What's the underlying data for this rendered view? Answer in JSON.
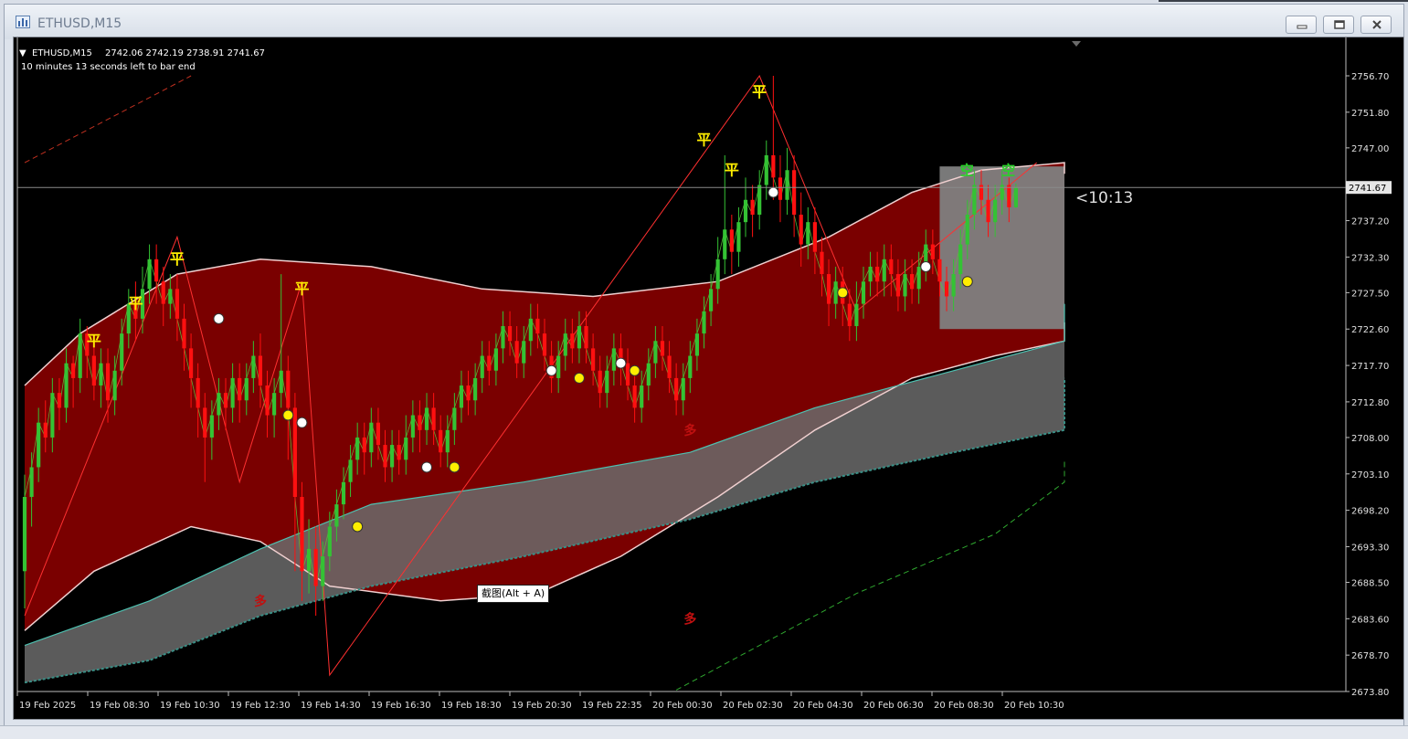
{
  "window": {
    "title": "ETHUSD,M15",
    "icon": "chart-window-icon",
    "buttons": [
      "minimize-icon",
      "restore-icon",
      "close-icon"
    ]
  },
  "chart": {
    "header_symbol": "ETHUSD,M15",
    "header_ohlc": "2742.06 2742.19 2738.91 2741.67",
    "countdown_text": "10 minutes 13 seconds left to bar end",
    "timer_label": "<10:13",
    "current_price": "2741.67",
    "tooltip": "截图(Alt + A)",
    "colors": {
      "background": "#000000",
      "band_fill": "#7a0000",
      "bull_candle": "#34c234",
      "bear_candle": "#ff1010",
      "grey_band": "#808080",
      "teal_line": "#4ec0b0",
      "signal_yellow": "#ffee00"
    }
  },
  "chart_data": {
    "type": "candlestick",
    "y_axis_ticks": [
      "2756.70",
      "2751.80",
      "2747.00",
      "2742.10",
      "2737.20",
      "2732.30",
      "2727.50",
      "2722.60",
      "2717.70",
      "2712.80",
      "2708.00",
      "2703.10",
      "2698.20",
      "2693.30",
      "2688.50",
      "2683.60",
      "2678.70",
      "2673.80"
    ],
    "x_axis_ticks": [
      "19 Feb 2025",
      "19 Feb 08:30",
      "19 Feb 10:30",
      "19 Feb 12:30",
      "19 Feb 14:30",
      "19 Feb 16:30",
      "19 Feb 18:30",
      "19 Feb 20:30",
      "19 Feb 22:35",
      "20 Feb 00:30",
      "20 Feb 02:30",
      "20 Feb 04:30",
      "20 Feb 06:30",
      "20 Feb 08:30",
      "20 Feb 10:30"
    ],
    "ylim": [
      2673.8,
      2756.7
    ],
    "upper_band": [
      [
        0,
        2715
      ],
      [
        8,
        2722
      ],
      [
        22,
        2730
      ],
      [
        34,
        2732
      ],
      [
        50,
        2731
      ],
      [
        66,
        2728
      ],
      [
        82,
        2727
      ],
      [
        100,
        2729
      ],
      [
        116,
        2735
      ],
      [
        128,
        2741
      ],
      [
        138,
        2744
      ],
      [
        150,
        2745
      ],
      [
        172,
        2744.5
      ],
      [
        190,
        2743.5
      ]
    ],
    "lower_band": [
      [
        0,
        2682
      ],
      [
        10,
        2690
      ],
      [
        24,
        2696
      ],
      [
        34,
        2694
      ],
      [
        44,
        2688
      ],
      [
        60,
        2686
      ],
      [
        74,
        2687
      ],
      [
        86,
        2692
      ],
      [
        100,
        2700
      ],
      [
        114,
        2709
      ],
      [
        128,
        2716
      ],
      [
        140,
        2719
      ],
      [
        156,
        2721
      ],
      [
        170,
        2722.5
      ],
      [
        190,
        2723.5
      ]
    ],
    "mid_line": [
      [
        0,
        2680
      ],
      [
        18,
        2686
      ],
      [
        34,
        2693
      ],
      [
        50,
        2699
      ],
      [
        72,
        2702
      ],
      [
        96,
        2706
      ],
      [
        114,
        2712
      ],
      [
        134,
        2717
      ],
      [
        154,
        2721
      ],
      [
        172,
        2724
      ],
      [
        190,
        2726
      ]
    ],
    "grey_lower": [
      [
        0,
        2675
      ],
      [
        18,
        2678
      ],
      [
        34,
        2684
      ],
      [
        50,
        2688
      ],
      [
        72,
        2692
      ],
      [
        96,
        2697
      ],
      [
        114,
        2702
      ],
      [
        134,
        2706
      ],
      [
        154,
        2709
      ],
      [
        172,
        2713
      ],
      [
        190,
        2716
      ]
    ],
    "green_dashed": [
      [
        94,
        2674
      ],
      [
        120,
        2687
      ],
      [
        140,
        2695
      ],
      [
        166,
        2702
      ],
      [
        190,
        2705
      ]
    ],
    "red_dashed": [
      [
        0,
        2745
      ],
      [
        24,
        2756.7
      ]
    ],
    "candles": [
      [
        2690,
        2700,
        2685,
        2703
      ],
      [
        2700,
        2704,
        2696,
        2706
      ],
      [
        2704,
        2710,
        2702,
        2712
      ],
      [
        2710,
        2708,
        2706,
        2713
      ],
      [
        2708,
        2714,
        2706,
        2716
      ],
      [
        2714,
        2712,
        2709,
        2716
      ],
      [
        2712,
        2718,
        2710,
        2720
      ],
      [
        2718,
        2716,
        2712,
        2719
      ],
      [
        2716,
        2722,
        2714,
        2724
      ],
      [
        2722,
        2719,
        2716,
        2723
      ],
      [
        2719,
        2715,
        2713,
        2721
      ],
      [
        2715,
        2718,
        2712,
        2720
      ],
      [
        2718,
        2713,
        2710,
        2720
      ],
      [
        2713,
        2717,
        2711,
        2719
      ],
      [
        2717,
        2722,
        2715,
        2724
      ],
      [
        2722,
        2726,
        2720,
        2728
      ],
      [
        2726,
        2724,
        2721,
        2729
      ],
      [
        2724,
        2728,
        2722,
        2731
      ],
      [
        2728,
        2732,
        2726,
        2734
      ],
      [
        2732,
        2729,
        2726,
        2734
      ],
      [
        2729,
        2726,
        2723,
        2731
      ],
      [
        2726,
        2728,
        2724,
        2730
      ],
      [
        2728,
        2724,
        2721,
        2730
      ],
      [
        2724,
        2720,
        2717,
        2726
      ],
      [
        2720,
        2716,
        2712,
        2722
      ],
      [
        2716,
        2712,
        2708,
        2718
      ],
      [
        2712,
        2708,
        2702,
        2714
      ],
      [
        2708,
        2711,
        2705,
        2713
      ],
      [
        2711,
        2714,
        2709,
        2716
      ],
      [
        2714,
        2712,
        2709,
        2716
      ],
      [
        2712,
        2716,
        2710,
        2718
      ],
      [
        2716,
        2713,
        2710,
        2718
      ],
      [
        2713,
        2716,
        2711,
        2718
      ],
      [
        2716,
        2719,
        2714,
        2721
      ],
      [
        2719,
        2715,
        2712,
        2722
      ],
      [
        2715,
        2711,
        2708,
        2717
      ],
      [
        2711,
        2714,
        2708,
        2716
      ],
      [
        2714,
        2717,
        2712,
        2730
      ],
      [
        2717,
        2712,
        2705,
        2719
      ],
      [
        2712,
        2700,
        2690,
        2714
      ],
      [
        2700,
        2690,
        2686,
        2702
      ],
      [
        2690,
        2693,
        2687,
        2697
      ],
      [
        2693,
        2688,
        2684,
        2696
      ],
      [
        2688,
        2692,
        2686,
        2694
      ],
      [
        2692,
        2696,
        2690,
        2698
      ],
      [
        2696,
        2699,
        2694,
        2701
      ],
      [
        2699,
        2702,
        2697,
        2704
      ],
      [
        2702,
        2705,
        2700,
        2707
      ],
      [
        2705,
        2708,
        2703,
        2710
      ],
      [
        2708,
        2706,
        2703,
        2710
      ],
      [
        2706,
        2710,
        2704,
        2712
      ],
      [
        2710,
        2707,
        2705,
        2712
      ],
      [
        2707,
        2704,
        2702,
        2709
      ],
      [
        2704,
        2707,
        2702,
        2709
      ],
      [
        2707,
        2705,
        2703,
        2709
      ],
      [
        2705,
        2708,
        2703,
        2711
      ],
      [
        2708,
        2711,
        2706,
        2713
      ],
      [
        2711,
        2709,
        2706,
        2713
      ],
      [
        2709,
        2712,
        2707,
        2714
      ],
      [
        2712,
        2709,
        2707,
        2714
      ],
      [
        2709,
        2706,
        2704,
        2711
      ],
      [
        2706,
        2709,
        2704,
        2711
      ],
      [
        2709,
        2712,
        2707,
        2714
      ],
      [
        2712,
        2715,
        2710,
        2717
      ],
      [
        2715,
        2713,
        2711,
        2717
      ],
      [
        2713,
        2716,
        2711,
        2718
      ],
      [
        2716,
        2719,
        2714,
        2721
      ],
      [
        2719,
        2717,
        2715,
        2721
      ],
      [
        2717,
        2720,
        2715,
        2722
      ],
      [
        2720,
        2723,
        2718,
        2725
      ],
      [
        2723,
        2721,
        2719,
        2725
      ],
      [
        2721,
        2718,
        2716,
        2723
      ],
      [
        2718,
        2721,
        2716,
        2723
      ],
      [
        2721,
        2724,
        2719,
        2726
      ],
      [
        2724,
        2722,
        2720,
        2726
      ],
      [
        2722,
        2719,
        2717,
        2724
      ],
      [
        2719,
        2716,
        2714,
        2721
      ],
      [
        2716,
        2719,
        2714,
        2721
      ],
      [
        2719,
        2722,
        2717,
        2724
      ],
      [
        2722,
        2720,
        2718,
        2724
      ],
      [
        2720,
        2723,
        2718,
        2725
      ],
      [
        2723,
        2720,
        2718,
        2725
      ],
      [
        2720,
        2717,
        2715,
        2722
      ],
      [
        2717,
        2714,
        2712,
        2719
      ],
      [
        2714,
        2717,
        2712,
        2719
      ],
      [
        2717,
        2720,
        2715,
        2722
      ],
      [
        2720,
        2718,
        2715,
        2722
      ],
      [
        2718,
        2715,
        2713,
        2720
      ],
      [
        2715,
        2712,
        2710,
        2717
      ],
      [
        2712,
        2715,
        2710,
        2717
      ],
      [
        2715,
        2718,
        2713,
        2720
      ],
      [
        2718,
        2721,
        2716,
        2723
      ],
      [
        2721,
        2719,
        2717,
        2723
      ],
      [
        2719,
        2716,
        2714,
        2721
      ],
      [
        2716,
        2713,
        2711,
        2718
      ],
      [
        2713,
        2716,
        2711,
        2718
      ],
      [
        2716,
        2719,
        2714,
        2721
      ],
      [
        2719,
        2722,
        2717,
        2724
      ],
      [
        2722,
        2725,
        2720,
        2727
      ],
      [
        2725,
        2728,
        2723,
        2730
      ],
      [
        2728,
        2732,
        2726,
        2735
      ],
      [
        2732,
        2736,
        2730,
        2746
      ],
      [
        2736,
        2733,
        2730,
        2738
      ],
      [
        2733,
        2737,
        2731,
        2739
      ],
      [
        2737,
        2740,
        2735,
        2743
      ],
      [
        2740,
        2738,
        2735,
        2742
      ],
      [
        2738,
        2742,
        2736,
        2744
      ],
      [
        2742,
        2746,
        2740,
        2748
      ],
      [
        2746,
        2743,
        2740,
        2756.7
      ],
      [
        2743,
        2740,
        2737,
        2746
      ],
      [
        2740,
        2744,
        2738,
        2747
      ],
      [
        2744,
        2738,
        2735,
        2746
      ],
      [
        2738,
        2734,
        2731,
        2741
      ],
      [
        2734,
        2737,
        2732,
        2739
      ],
      [
        2737,
        2733,
        2730,
        2739
      ],
      [
        2733,
        2730,
        2727,
        2735
      ],
      [
        2730,
        2726,
        2723,
        2732
      ],
      [
        2726,
        2729,
        2724,
        2731
      ],
      [
        2729,
        2726,
        2723,
        2731
      ],
      [
        2726,
        2723,
        2721,
        2728
      ],
      [
        2723,
        2726,
        2721,
        2729
      ],
      [
        2726,
        2729,
        2724,
        2731
      ],
      [
        2729,
        2731,
        2727,
        2733
      ],
      [
        2731,
        2729,
        2727,
        2733
      ],
      [
        2729,
        2732,
        2727,
        2734
      ],
      [
        2732,
        2730,
        2727,
        2734
      ],
      [
        2730,
        2727,
        2725,
        2732
      ],
      [
        2727,
        2730,
        2725,
        2732
      ],
      [
        2730,
        2728,
        2726,
        2732
      ],
      [
        2728,
        2731,
        2726,
        2733
      ],
      [
        2731,
        2734,
        2729,
        2736
      ],
      [
        2734,
        2732,
        2730,
        2736
      ],
      [
        2732,
        2729,
        2727,
        2734
      ],
      [
        2729,
        2727,
        2725,
        2731
      ],
      [
        2727,
        2730,
        2725,
        2732
      ],
      [
        2730,
        2734,
        2728,
        2736
      ],
      [
        2734,
        2738,
        2732,
        2740
      ],
      [
        2738,
        2742,
        2736,
        2744
      ],
      [
        2742,
        2740,
        2738,
        2744
      ],
      [
        2740,
        2737,
        2735,
        2742
      ],
      [
        2737,
        2740,
        2735,
        2742
      ],
      [
        2740,
        2742,
        2738,
        2744
      ],
      [
        2742,
        2739,
        2737,
        2743
      ],
      [
        2739,
        2741.67,
        2738.91,
        2742.19
      ]
    ],
    "signals": {
      "exit_labels": [
        [
          10,
          2721
        ],
        [
          16,
          2726
        ],
        [
          22,
          2732
        ],
        [
          40,
          2728
        ],
        [
          98,
          2748
        ],
        [
          102,
          2744
        ],
        [
          106,
          2754.5
        ]
      ],
      "entry_labels": [
        [
          34,
          2686
        ],
        [
          96,
          2709
        ],
        [
          96,
          2683.6
        ]
      ],
      "white_dots": [
        [
          28,
          2724
        ],
        [
          40,
          2710
        ],
        [
          58,
          2704
        ],
        [
          76,
          2717
        ],
        [
          86,
          2718
        ],
        [
          108,
          2741
        ],
        [
          130,
          2731
        ]
      ],
      "yellow_dots": [
        [
          38,
          2711
        ],
        [
          48,
          2696
        ],
        [
          62,
          2704
        ],
        [
          80,
          2716
        ],
        [
          88,
          2717
        ],
        [
          118,
          2727.5
        ],
        [
          136,
          2729
        ]
      ],
      "green_labels": [
        [
          136,
          2744
        ],
        [
          142,
          2744
        ]
      ]
    }
  }
}
